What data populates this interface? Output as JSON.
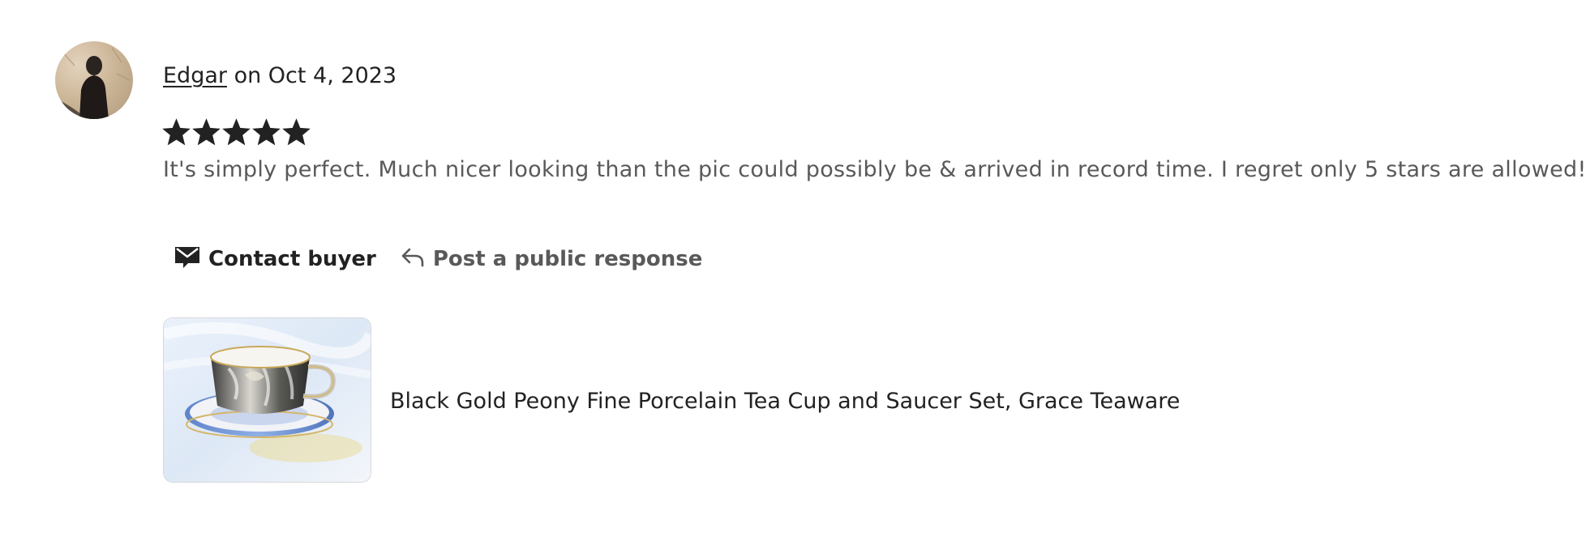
{
  "review": {
    "reviewer_name": "Edgar",
    "date_text": " on Oct 4, 2023",
    "rating": 5,
    "rating_max": 5,
    "text": "It's simply perfect. Much nicer looking than the pic could possibly be & arrived in record time. I regret only 5 stars are allowed!"
  },
  "actions": {
    "contact_label": "Contact buyer",
    "contact_icon": "envelope-icon",
    "respond_label": "Post a public response",
    "respond_icon": "reply-arrow-icon"
  },
  "product": {
    "title": "Black Gold Peony Fine Porcelain Tea Cup and Saucer Set, Grace Teaware"
  },
  "colors": {
    "text_primary": "#222222",
    "text_secondary": "#595959",
    "star": "#222222"
  }
}
